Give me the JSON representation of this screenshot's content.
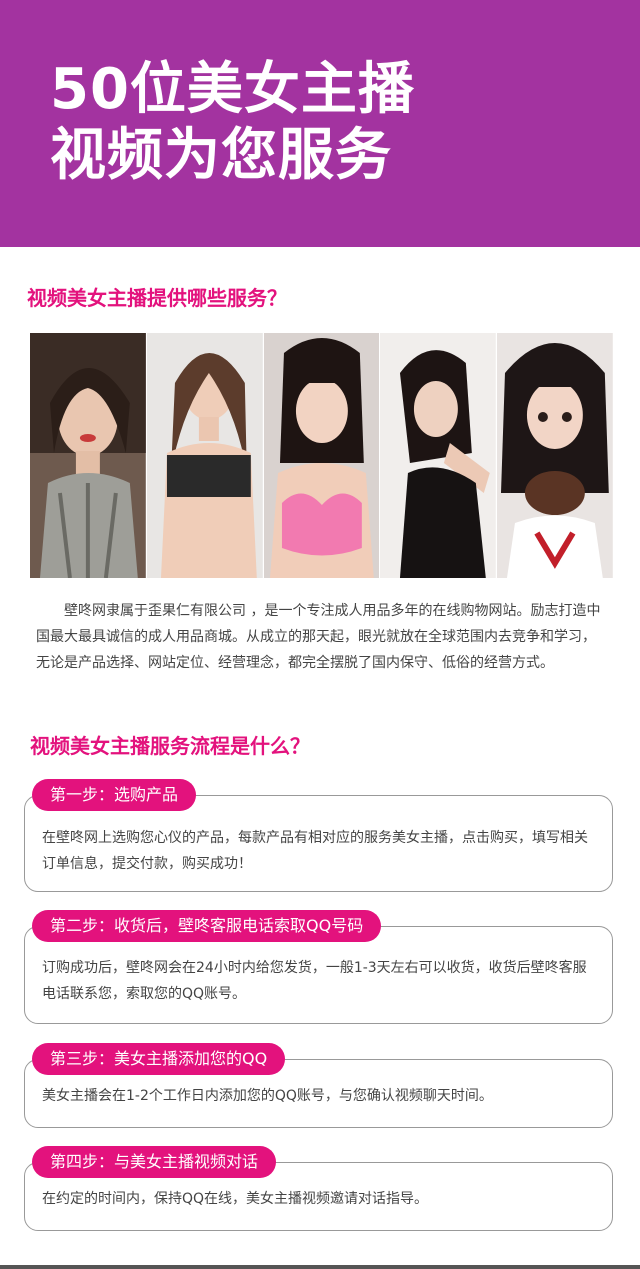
{
  "banner": {
    "line1": "50位美女主播",
    "line2": "视频为您服务",
    "color": "#a333a0"
  },
  "section1": {
    "title": "视频美女主播提供哪些服务？"
  },
  "photos": [
    {
      "name": "anchor-photo-1"
    },
    {
      "name": "anchor-photo-2"
    },
    {
      "name": "anchor-photo-3"
    },
    {
      "name": "anchor-photo-4"
    },
    {
      "name": "anchor-photo-5"
    }
  ],
  "intro": {
    "text": "壁咚网隶属于歪果仁有限公司 ，是一个专注成人用品多年的在线购物网站。励志打造中国最大最具诚信的成人用品商城。从成立的那天起，眼光就放在全球范围内去竞争和学习，无论是产品选择、网站定位、经营理念，都完全摆脱了国内保守、低俗的经营方式。"
  },
  "section2": {
    "title": "视频美女主播服务流程是什么？"
  },
  "steps": [
    {
      "label": "第一步：选购产品",
      "desc": "在壁咚网上选购您心仪的产品，每款产品有相对应的服务美女主播，点击购买，填写相关订单信息，提交付款，购买成功！"
    },
    {
      "label": "第二步：收货后，壁咚客服电话索取QQ号码",
      "desc": "订购成功后，壁咚网会在24小时内给您发货，一般1-3天左右可以收货，收货后壁咚客服电话联系您，索取您的QQ账号。"
    },
    {
      "label": "第三步：美女主播添加您的QQ",
      "desc": "美女主播会在1-2个工作日内添加您的QQ账号，与您确认视频聊天时间。"
    },
    {
      "label": "第四步：与美女主播视频对话",
      "desc": "在约定的时间内，保持QQ在线，美女主播视频邀请对话指导。"
    }
  ],
  "colors": {
    "accent": "#e3127d",
    "banner": "#a333a0",
    "text": "#444444"
  }
}
